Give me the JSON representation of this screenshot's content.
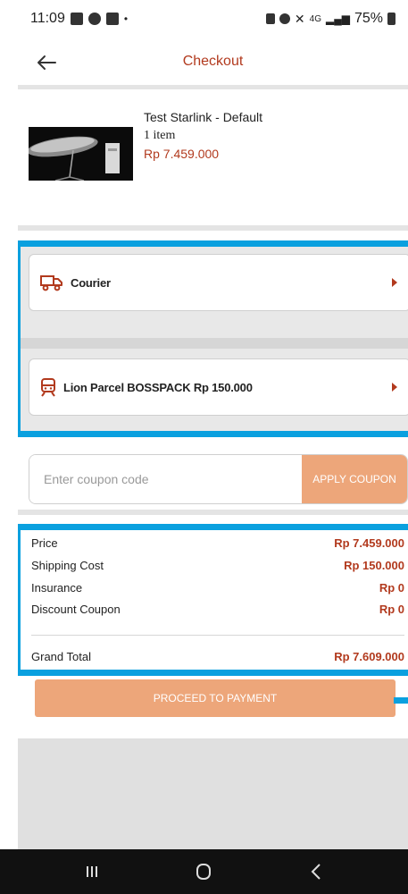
{
  "status_bar": {
    "time": "11:09",
    "battery": "75%",
    "network": "4G"
  },
  "header": {
    "title": "Checkout",
    "back_icon": "arrow-left-icon"
  },
  "product": {
    "name": "Test Starlink - Default",
    "quantity": "1 item",
    "price": "Rp 7.459.000"
  },
  "shipping": {
    "courier_label": "Courier",
    "courier_icon": "truck-icon",
    "service_label": "Lion Parcel BOSSPACK Rp 150.000",
    "service_icon": "train-icon"
  },
  "coupon": {
    "placeholder": "Enter coupon code",
    "button_label": "APPLY COUPON"
  },
  "summary": {
    "rows": [
      {
        "label": "Price",
        "value": "Rp 7.459.000"
      },
      {
        "label": "Shipping Cost",
        "value": "Rp 150.000"
      },
      {
        "label": "Insurance",
        "value": "Rp 0"
      },
      {
        "label": "Discount Coupon",
        "value": "Rp 0"
      }
    ],
    "total_label": "Grand Total",
    "total_value": "Rp 7.609.000"
  },
  "proceed_label": "PROCEED TO PAYMENT",
  "colors": {
    "accent": "#b23a1e",
    "button": "#eda67a",
    "highlight": "#0aa0df"
  }
}
